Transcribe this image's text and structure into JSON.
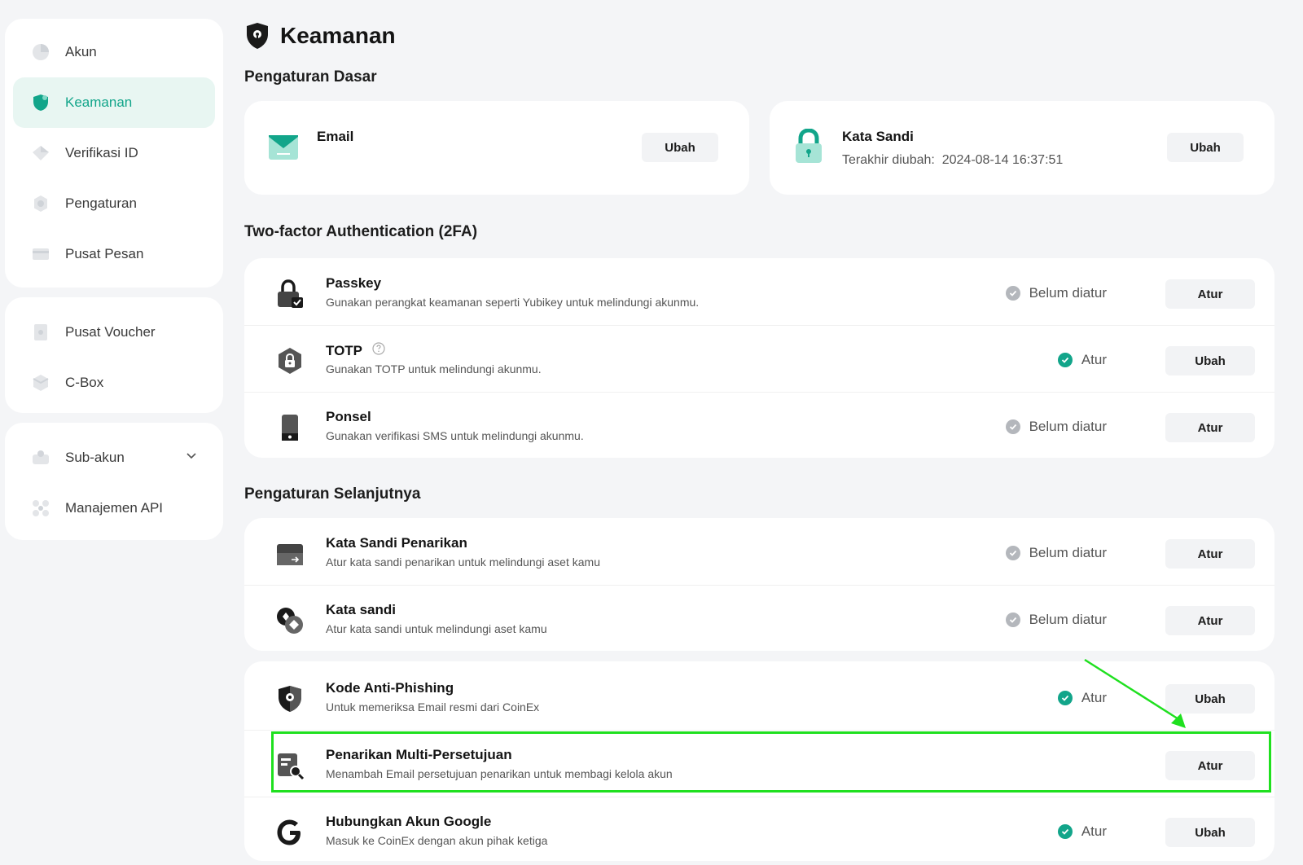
{
  "sidebar": {
    "group1": [
      {
        "label": "Akun",
        "icon": "pie-icon"
      },
      {
        "label": "Keamanan",
        "icon": "shield-icon",
        "active": true
      },
      {
        "label": "Verifikasi ID",
        "icon": "diamond-icon"
      },
      {
        "label": "Pengaturan",
        "icon": "gear-icon"
      },
      {
        "label": "Pusat Pesan",
        "icon": "message-icon"
      }
    ],
    "group2": [
      {
        "label": "Pusat Voucher",
        "icon": "voucher-icon"
      },
      {
        "label": "C-Box",
        "icon": "box-icon"
      }
    ],
    "group3": [
      {
        "label": "Sub-akun",
        "icon": "sub-account-icon"
      },
      {
        "label": "Manajemen API",
        "icon": "api-icon"
      }
    ]
  },
  "header": {
    "title": "Keamanan"
  },
  "basic": {
    "title": "Pengaturan Dasar",
    "email": {
      "title": "Email",
      "button": "Ubah"
    },
    "password": {
      "title": "Kata Sandi",
      "sub_label": "Terakhir diubah:",
      "sub_value": "2024-08-14 16:37:51",
      "button": "Ubah"
    }
  },
  "tfa": {
    "title": "Two-factor Authentication (2FA)",
    "rows": [
      {
        "title": "Passkey",
        "desc": "Gunakan perangkat keamanan seperti Yubikey untuk melindungi akunmu.",
        "status": "Belum diatur",
        "button": "Atur"
      },
      {
        "title": "TOTP",
        "desc": "Gunakan TOTP untuk melindungi akunmu.",
        "status": "Atur",
        "button": "Ubah"
      },
      {
        "title": "Ponsel",
        "desc": "Gunakan verifikasi SMS untuk melindungi akunmu.",
        "status": "Belum diatur",
        "button": "Atur"
      }
    ]
  },
  "advanced": {
    "title": "Pengaturan Selanjutnya",
    "rows": [
      {
        "title": "Kata Sandi Penarikan",
        "desc": "Atur kata sandi penarikan untuk melindungi aset kamu",
        "status": "Belum diatur",
        "button": "Atur"
      },
      {
        "title": "Kata sandi",
        "desc": "Atur kata sandi untuk melindungi aset kamu",
        "status": "Belum diatur",
        "button": "Atur"
      }
    ],
    "rows2": [
      {
        "title": "Kode Anti-Phishing",
        "desc": "Untuk memeriksa Email resmi dari CoinEx",
        "status": "Atur",
        "button": "Ubah"
      },
      {
        "title": "Penarikan Multi-Persetujuan",
        "desc": "Menambah Email persetujuan penarikan untuk membagi kelola akun",
        "button": "Atur"
      },
      {
        "title": "Hubungkan Akun Google",
        "desc": "Masuk ke CoinEx dengan akun pihak ketiga",
        "status": "Atur",
        "button": "Ubah"
      }
    ]
  },
  "colors": {
    "accent": "#12a58a",
    "status_done": "#12a58a",
    "status_none": "#b4b7bc",
    "highlight": "#1fe01f"
  }
}
